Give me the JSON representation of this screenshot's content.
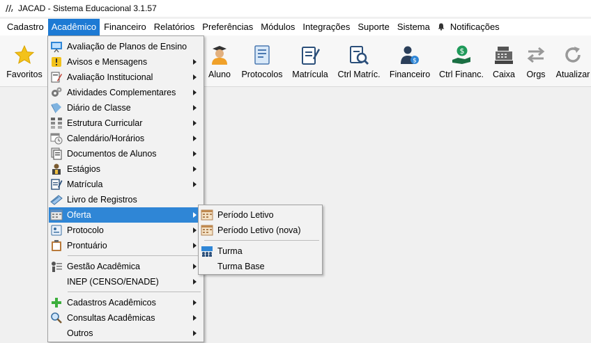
{
  "window": {
    "title": "JACAD - Sistema Educacional 3.1.57",
    "logo_icon": "jacad-logo-icon"
  },
  "menubar": {
    "items": [
      "Cadastro",
      "Acadêmico",
      "Financeiro",
      "Relatórios",
      "Preferências",
      "Módulos",
      "Integrações",
      "Suporte",
      "Sistema"
    ],
    "notifications": "Notificações",
    "active": "Acadêmico"
  },
  "toolbar": {
    "favoritos": "Favoritos",
    "aluno": "Aluno",
    "protocolos": "Protocolos",
    "matricula": "Matrícula",
    "ctrl_matric": "Ctrl Matríc.",
    "financeiro": "Financeiro",
    "ctrl_financ": "Ctrl Financ.",
    "caixa": "Caixa",
    "orgs": "Orgs",
    "atualizar": "Atualizar"
  },
  "academico_menu": {
    "items": [
      {
        "label": "Avaliação de Planos de Ensino",
        "icon": "presentation-board-icon",
        "submenu": false
      },
      {
        "label": "Avisos e Mensagens",
        "icon": "warning-icon",
        "submenu": true
      },
      {
        "label": "Avaliação Institucional",
        "icon": "pencil-form-icon",
        "submenu": true
      },
      {
        "label": "Atividades Complementares",
        "icon": "gears-icon",
        "submenu": true
      },
      {
        "label": "Diário de Classe",
        "icon": "book-icon",
        "submenu": true
      },
      {
        "label": "Estrutura Curricular",
        "icon": "structure-icon",
        "submenu": true
      },
      {
        "label": "Calendário/Horários",
        "icon": "calendar-clock-icon",
        "submenu": true
      },
      {
        "label": "Documentos de Alunos",
        "icon": "documents-icon",
        "submenu": true
      },
      {
        "label": "Estágios",
        "icon": "intern-icon",
        "submenu": true
      },
      {
        "label": "Matrícula",
        "icon": "form-pencil-icon",
        "submenu": true
      },
      {
        "label": "Livro de Registros",
        "icon": "register-book-icon",
        "submenu": false
      },
      {
        "label": "Oferta",
        "icon": "calendar-grid-icon",
        "submenu": true
      },
      {
        "label": "Protocolo",
        "icon": "protocol-icon",
        "submenu": true
      },
      {
        "label": "Prontuário",
        "icon": "clipboard-icon",
        "submenu": true
      },
      {
        "label": "Gestão Acadêmica",
        "icon": "management-icon",
        "submenu": true
      },
      {
        "label": "INEP (CENSO/ENADE)",
        "icon": "",
        "submenu": true
      },
      {
        "label": "Cadastros Acadêmicos",
        "icon": "plus-icon",
        "submenu": true
      },
      {
        "label": "Consultas Acadêmicas",
        "icon": "magnifier-icon",
        "submenu": true
      },
      {
        "label": "Outros",
        "icon": "",
        "submenu": true
      }
    ],
    "highlighted": "Oferta"
  },
  "oferta_submenu": {
    "items": [
      {
        "label": "Período Letivo",
        "icon": "calendar-icon"
      },
      {
        "label": "Período Letivo (nova)",
        "icon": "calendar-icon"
      },
      {
        "label": "Turma",
        "icon": "class-group-icon"
      },
      {
        "label": "Turma Base",
        "icon": ""
      }
    ]
  },
  "colors": {
    "accent": "#1d7ad4",
    "highlight": "#2f86d6",
    "menu_bg": "#f2f2f2",
    "window_bg": "#f0f0f0"
  }
}
